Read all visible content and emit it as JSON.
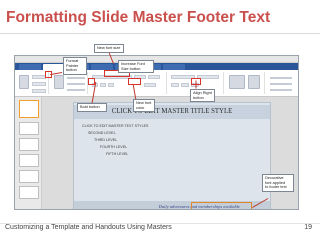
{
  "slide": {
    "title": "Formatting Slide Master Footer Text",
    "footer_left": "Customizing a Template and Handouts Using Masters",
    "page_number": "19"
  },
  "master_slide": {
    "title": "CLICK TO EDIT MASTER TITLE STYLE",
    "levels": [
      "CLICK TO EDIT MASTER TEXT STYLES",
      "SECOND LEVEL",
      "THIRD LEVEL",
      "FOURTH LEVEL",
      "FIFTH LEVEL"
    ],
    "footer_text": "Daily adventures and memberships available"
  },
  "callouts": {
    "new_font_size": "New font size",
    "format_painter": "Format\nPainter\nbutton",
    "increase_font": "Increase Font\nSize button",
    "align_right": "Align Right\nbutton",
    "bold": "Bold button",
    "new_font_color": "New font\ncolor",
    "decorative_font": "Decorative\nfont applied\nto footer text"
  },
  "colors": {
    "title": "#c9504d",
    "callout_line": "#c0392b",
    "highlight": "#d9342b",
    "ribbon": "#2b579a"
  }
}
